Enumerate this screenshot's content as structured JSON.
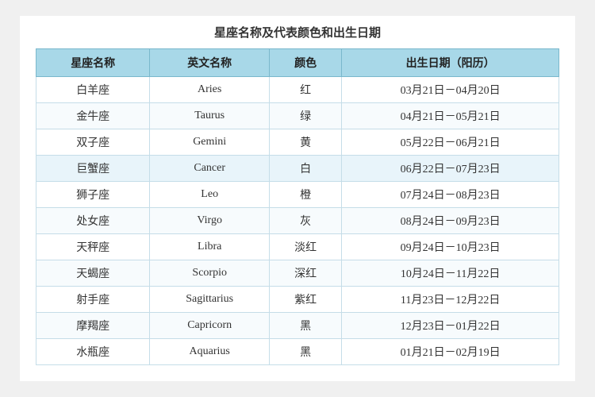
{
  "title": "星座名称及代表颜色和出生日期",
  "columns": [
    "星座名称",
    "英文名称",
    "颜色",
    "出生日期（阳历）"
  ],
  "rows": [
    {
      "zh": "白羊座",
      "en": "Aries",
      "color": "红",
      "dates": "03月21日－04月20日"
    },
    {
      "zh": "金牛座",
      "en": "Taurus",
      "color": "绿",
      "dates": "04月21日－05月21日"
    },
    {
      "zh": "双子座",
      "en": "Gemini",
      "color": "黄",
      "dates": "05月22日－06月21日"
    },
    {
      "zh": "巨蟹座",
      "en": "Cancer",
      "color": "白",
      "dates": "06月22日－07月23日"
    },
    {
      "zh": "狮子座",
      "en": "Leo",
      "color": "橙",
      "dates": "07月24日－08月23日"
    },
    {
      "zh": "处女座",
      "en": "Virgo",
      "color": "灰",
      "dates": "08月24日－09月23日"
    },
    {
      "zh": "天秤座",
      "en": "Libra",
      "color": "淡红",
      "dates": "09月24日－10月23日"
    },
    {
      "zh": "天蝎座",
      "en": "Scorpio",
      "color": "深红",
      "dates": "10月24日－11月22日"
    },
    {
      "zh": "射手座",
      "en": "Sagittarius",
      "color": "紫红",
      "dates": "11月23日－12月22日"
    },
    {
      "zh": "摩羯座",
      "en": "Capricorn",
      "color": "黑",
      "dates": "12月23日－01月22日"
    },
    {
      "zh": "水瓶座",
      "en": "Aquarius",
      "color": "黑",
      "dates": "01月21日－02月19日"
    }
  ]
}
